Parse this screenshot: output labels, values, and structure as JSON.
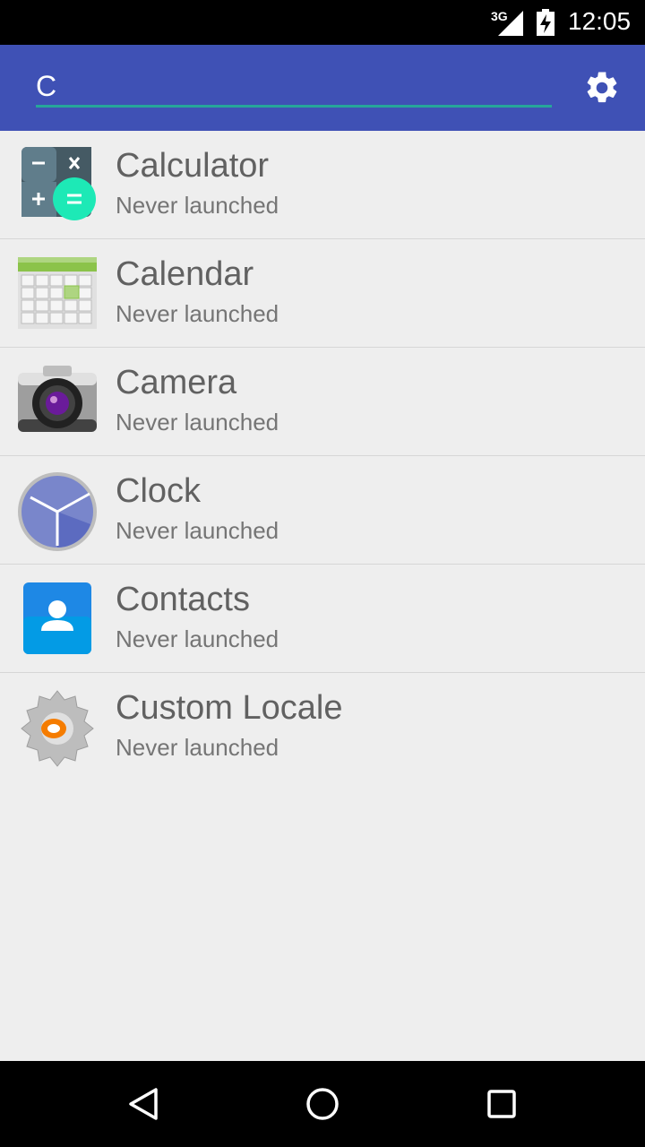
{
  "status_bar": {
    "network": "3G",
    "time": "12:05"
  },
  "search": {
    "value": "C"
  },
  "apps": [
    {
      "name": "Calculator",
      "subtitle": "Never launched",
      "icon": "calculator-icon"
    },
    {
      "name": "Calendar",
      "subtitle": "Never launched",
      "icon": "calendar-icon"
    },
    {
      "name": "Camera",
      "subtitle": "Never launched",
      "icon": "camera-icon"
    },
    {
      "name": "Clock",
      "subtitle": "Never launched",
      "icon": "clock-icon"
    },
    {
      "name": "Contacts",
      "subtitle": "Never launched",
      "icon": "contacts-icon"
    },
    {
      "name": "Custom Locale",
      "subtitle": "Never launched",
      "icon": "custom-locale-icon"
    }
  ],
  "colors": {
    "toolbar": "#3f51b5",
    "accent": "#26a69a",
    "background": "#eeeeee",
    "status_bar": "#000000"
  },
  "nav": {
    "back_icon": "back-icon",
    "home_icon": "home-icon",
    "recents_icon": "recents-icon"
  }
}
